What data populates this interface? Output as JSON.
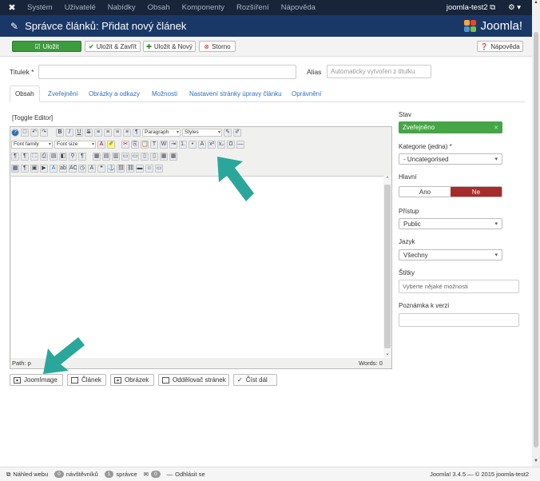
{
  "topnav": {
    "menu": [
      "Systém",
      "Uživatelé",
      "Nabídky",
      "Obsah",
      "Komponenty",
      "Rozšíření",
      "Nápověda"
    ],
    "site_link": "joomla-test2",
    "gear": "⚙ ▾"
  },
  "title": {
    "text": "Správce článků: Přidat nový článek",
    "logo": "Joomla!"
  },
  "toolbar": {
    "save": "Uložit",
    "save_close": "Uložit & Zavřít",
    "save_new": "Uložit & Nový",
    "cancel": "Storno",
    "help": "Nápověda"
  },
  "form": {
    "title_label": "Titulek *",
    "alias_label": "Alias",
    "alias_placeholder": "Automaticky vytvořen z titulku"
  },
  "tabs": [
    "Obsah",
    "Zveřejnění",
    "Obrázky a odkazy",
    "Možnosti",
    "Nastavení stránky úpravy článku",
    "Oprávnění"
  ],
  "editor": {
    "toggle": "[Toggle Editor]",
    "format_select": "Paragraph",
    "styles_select": "Styles",
    "font_family": "Font family",
    "font_size": "Font size",
    "path": "Path: p",
    "words": "Words: 0"
  },
  "bottom_buttons": [
    "JoomImage",
    "Článek",
    "Obrázek",
    "Oddělovač stránek",
    "Číst dál"
  ],
  "sidebar": {
    "state_label": "Stav",
    "state_value": "Zveřejněno",
    "category_label": "Kategorie (jedna) *",
    "category_value": "- Uncategorised",
    "featured_label": "Hlavní",
    "featured_yes": "Ano",
    "featured_no": "Ne",
    "access_label": "Přístup",
    "access_value": "Public",
    "language_label": "Jazyk",
    "language_value": "Všechny",
    "tags_label": "Štítky",
    "tags_placeholder": "Vyberte nějaké možnosti",
    "note_label": "Poznámka k verzi"
  },
  "footer": {
    "view_site": "Náhled webu",
    "visitors_count": "0",
    "visitors_label": "návštěvníků",
    "admins_count": "1",
    "admins_label": "správce",
    "messages_count": "0",
    "logout": "Odhlásit se",
    "version": "Joomla! 3.4.5 — © 2015 joomla-test2"
  },
  "colors": {
    "navbar": "#17243a",
    "titlebar": "#1a3867",
    "save_green": "#3c9c3e",
    "published_green": "#46a546",
    "no_red": "#a72b2b",
    "arrow_teal": "#2aa79a"
  }
}
